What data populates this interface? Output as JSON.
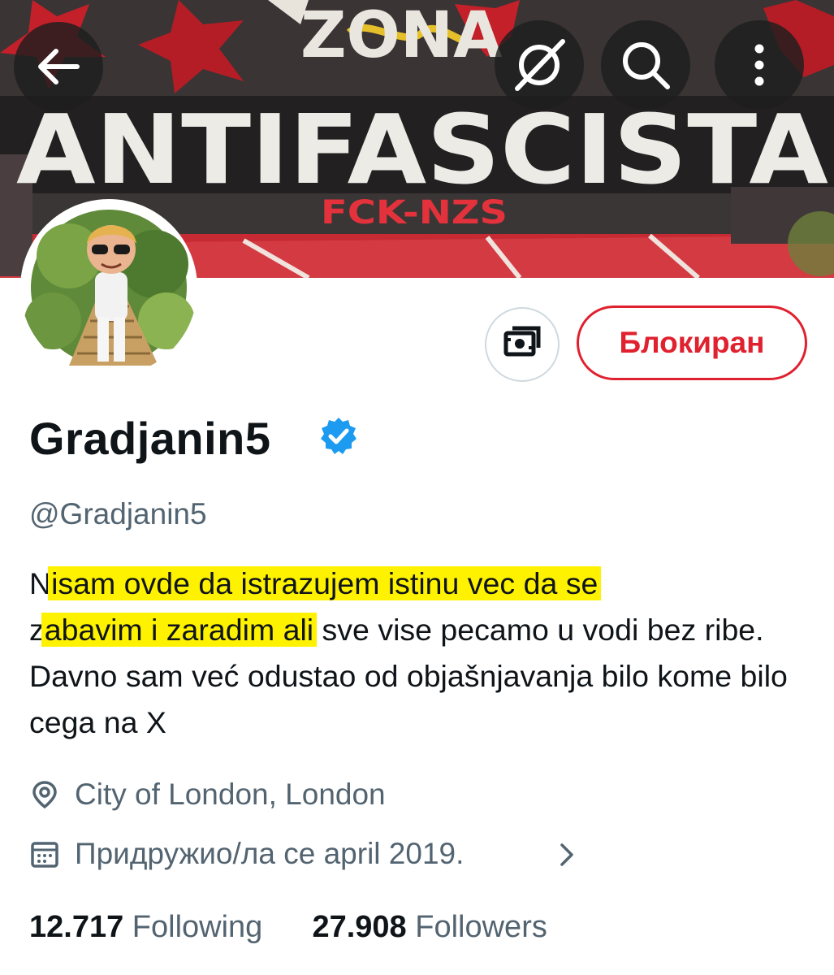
{
  "banner": {
    "graffiti_line1": "ZONA",
    "graffiti_line2": "ANTIFASCISTA",
    "graffiti_tag": "FCK-NZS"
  },
  "header": {
    "back_icon": "arrow-left-icon",
    "grok_icon": "grok-icon",
    "search_icon": "search-icon",
    "more_icon": "more-vertical-icon"
  },
  "profile": {
    "display_name": "Gradjanin5",
    "verified": true,
    "handle": "@Gradjanin5",
    "bio": {
      "p1_plain": "N",
      "p1_highlight": "isam ovde da istrazujem istinu vec da se",
      "p2_plain": "z",
      "p2_highlight": "abavim i zaradim ali",
      "p3_plain": " sve vise pecamo u vodi bez ribe. Davno sam već odustao od objašnjavanja bilo kome bilo cega na X"
    },
    "location": "City of London, London",
    "joined": "Придружио/ла се april 2019.",
    "following_count": "12.717",
    "following_label": "Following",
    "followers_count": "27.908",
    "followers_label": "Followers"
  },
  "actions": {
    "tip_icon": "money-tip-icon",
    "blocked_label": "Блокиран"
  },
  "colors": {
    "blocked_red": "#e0212f",
    "verified_blue": "#1d9bf0",
    "highlight_yellow": "#fff200",
    "secondary_text": "#536471"
  }
}
